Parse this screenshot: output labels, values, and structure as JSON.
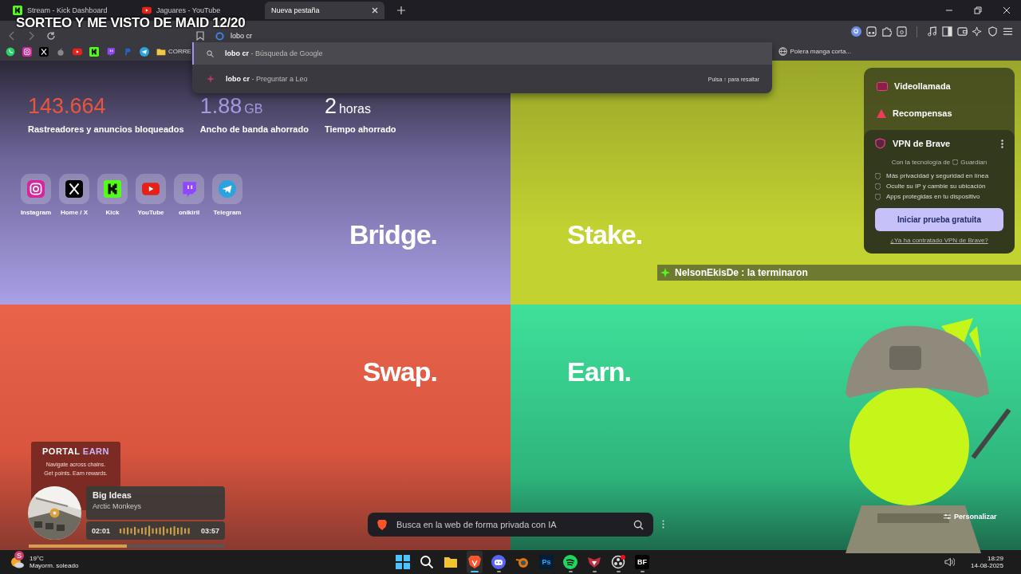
{
  "stream_overlay": {
    "title": "SORTEO Y ME VISTO DE MAID 12/20"
  },
  "tabs": [
    {
      "label": "Stream - Kick Dashboard",
      "kind": "kick",
      "selected": false
    },
    {
      "label": "Jaguares - YouTube",
      "kind": "youtube",
      "selected": false
    },
    {
      "label": "Nueva pestaña",
      "kind": "blank",
      "selected": true
    }
  ],
  "address_bar": {
    "value": "lobo cr"
  },
  "omnibox_suggestions": [
    {
      "kind": "search",
      "query": "lobo cr",
      "suffix": " - Búsqueda de Google",
      "selected": true
    },
    {
      "kind": "leo",
      "query": "lobo cr",
      "suffix": " - Preguntar a Leo",
      "hint": "Pulsa ↑ para resaltar",
      "selected": false
    }
  ],
  "bookmarks": [
    {
      "kind": "whatsapp"
    },
    {
      "kind": "instagram"
    },
    {
      "kind": "x"
    },
    {
      "kind": "apple"
    },
    {
      "kind": "youtube"
    },
    {
      "kind": "kick"
    },
    {
      "kind": "twitch"
    },
    {
      "kind": "paypal"
    },
    {
      "kind": "telegram"
    },
    {
      "kind": "folder",
      "label": "CORRE"
    }
  ],
  "bookmark_right": {
    "label": "Polera manga corta..."
  },
  "stats": [
    {
      "value": "143.664",
      "label": "Rastreadores y anuncios bloqueados",
      "color": "#e8553f"
    },
    {
      "value": "1.88",
      "unit": "GB",
      "label": "Ancho de banda ahorrado",
      "color": "#a49be0"
    },
    {
      "value": "2",
      "unit": "horas",
      "label": "Tiempo ahorrado",
      "color": "#ffffff"
    }
  ],
  "shortcuts": [
    {
      "label": "Instagram",
      "kind": "instagram"
    },
    {
      "label": "Home / X",
      "kind": "x"
    },
    {
      "label": "Kick",
      "kind": "kick"
    },
    {
      "label": "YouTube",
      "kind": "youtube"
    },
    {
      "label": "onikiril",
      "kind": "twitch"
    },
    {
      "label": "Telegram",
      "kind": "telegram"
    }
  ],
  "tiles": [
    {
      "label": "Bridge.",
      "color": "#a9a0e6"
    },
    {
      "label": "Stake.",
      "color": "#c2d231"
    },
    {
      "label": "Swap.",
      "color": "#e8634a"
    },
    {
      "label": "Earn.",
      "color": "#3fe09a"
    }
  ],
  "side_panel": {
    "items": [
      {
        "label": "Videollamada",
        "kind": "video"
      },
      {
        "label": "Recompensas",
        "kind": "rewards"
      }
    ],
    "vpn": {
      "title": "VPN de Brave",
      "powered_by": "Con la tecnología de",
      "partner": "Guardian",
      "features": [
        "Más privacidad y seguridad en línea",
        "Oculte su IP y cambie su ubicación",
        "Apps protegidas en tu dispositivo"
      ],
      "button": "Iniciar prueba gratuita",
      "link": "¿Ya ha contratado VPN de Brave?"
    }
  },
  "chat_message": {
    "user": "NelsonEkisDe",
    "text": ": la terminaron"
  },
  "portal_card": {
    "brand_1": "PORTAL",
    "brand_2": "EARN",
    "lines": [
      "Navigate across chains.",
      "Get points. Earn rewards."
    ]
  },
  "now_playing": {
    "title": "Big Ideas",
    "artist": "Arctic Monkeys",
    "elapsed": "02:01",
    "total": "03:57",
    "level": 0.5
  },
  "search": {
    "placeholder": "Busca en la web de forma privada con IA"
  },
  "customize": {
    "label": "Personalizar"
  },
  "taskbar": {
    "weather": {
      "temp": "19°C",
      "desc": "Mayorm. soleado",
      "badge": "S"
    },
    "apps": [
      {
        "kind": "start",
        "open": false,
        "selected": false
      },
      {
        "kind": "search",
        "open": false,
        "selected": false
      },
      {
        "kind": "explorer",
        "open": false,
        "selected": false
      },
      {
        "kind": "brave",
        "open": true,
        "selected": true
      },
      {
        "kind": "discord",
        "open": true,
        "selected": false
      },
      {
        "kind": "blender",
        "open": false,
        "selected": false
      },
      {
        "kind": "photoshop",
        "text": "Ps",
        "open": false,
        "selected": false
      },
      {
        "kind": "spotify",
        "open": true,
        "selected": false
      },
      {
        "kind": "valorant",
        "open": true,
        "selected": false
      },
      {
        "kind": "obs",
        "open": true,
        "selected": false
      },
      {
        "kind": "bf",
        "text": "BF",
        "open": true,
        "selected": false
      }
    ],
    "time": "18:29",
    "date": "14-08-2025"
  }
}
